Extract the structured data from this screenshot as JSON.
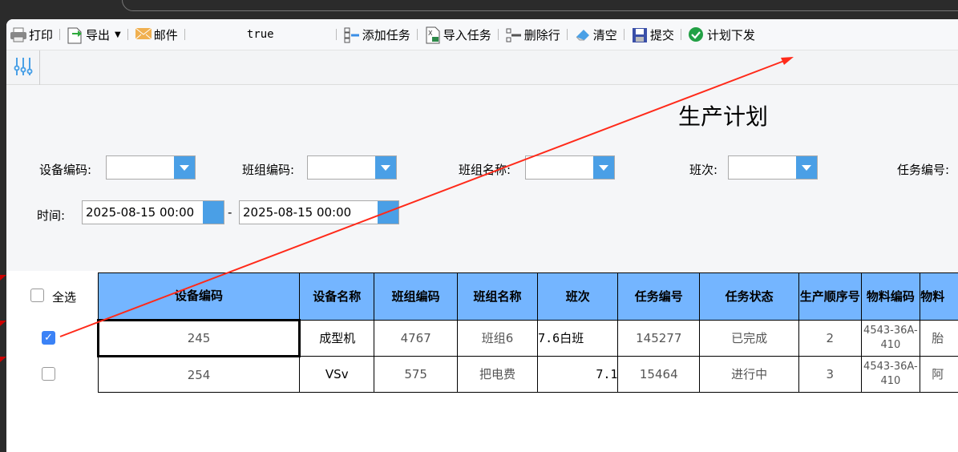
{
  "toolbar": {
    "items": [
      {
        "label": "打印",
        "icon": "printer-icon"
      },
      {
        "label": "导出",
        "icon": "export-icon",
        "dropdown": true
      },
      {
        "label": "邮件",
        "icon": "mail-icon"
      },
      {
        "label": "true",
        "icon": ""
      },
      {
        "label": "添加任务",
        "icon": "add-task-icon"
      },
      {
        "label": "导入任务",
        "icon": "excel-import-icon"
      },
      {
        "label": "删除行",
        "icon": "delete-row-icon"
      },
      {
        "label": "清空",
        "icon": "eraser-icon"
      },
      {
        "label": "提交",
        "icon": "save-icon"
      },
      {
        "label": "计划下发",
        "icon": "check-circle-icon"
      }
    ]
  },
  "form": {
    "title": "生产计划",
    "equipment_code_label": "设备编码:",
    "team_code_label": "班组编码:",
    "team_name_label": "班组名称:",
    "shift_label": "班次:",
    "task_no_label": "任务编号:",
    "time_label": "时间:",
    "date_from": "2025-08-15 00:00",
    "date_sep": "-",
    "date_to": "2025-08-15 00:00"
  },
  "table": {
    "select_all_label": "全选",
    "columns": [
      "设备编码",
      "设备名称",
      "班组编码",
      "班组名称",
      "班次",
      "任务编号",
      "任务状态",
      "生产顺序号",
      "物料编码",
      "物料"
    ],
    "rows": [
      {
        "checked": true,
        "cells": [
          "245",
          "成型机",
          "4767",
          "班组6",
          "7.6白班",
          "145277",
          "已完成",
          "2",
          "4543-36A-410",
          "胎"
        ]
      },
      {
        "checked": false,
        "cells": [
          "254",
          "VSv",
          "575",
          "把电费",
          "7.1",
          "15464",
          "进行中",
          "3",
          "4543-36A-410",
          "阿"
        ]
      }
    ]
  },
  "colors": {
    "accent": "#4a9fe6",
    "header_bg": "#74b5ff",
    "annotation": "#ff2a1a"
  }
}
